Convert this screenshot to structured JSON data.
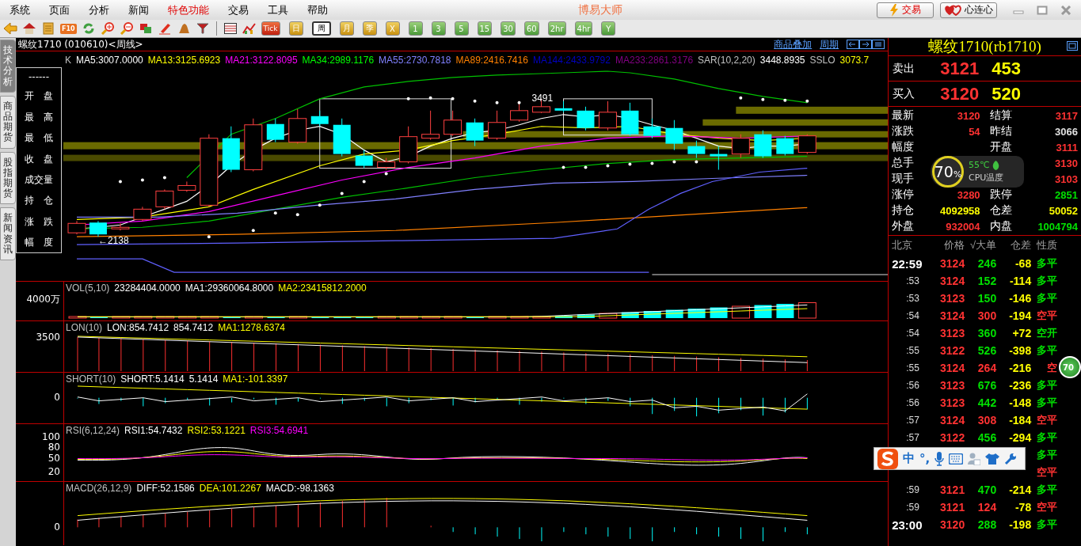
{
  "menu": [
    {
      "label": "系统",
      "highlight": false
    },
    {
      "label": "页面",
      "highlight": false
    },
    {
      "label": "分析",
      "highlight": false
    },
    {
      "label": "新闻",
      "highlight": false
    },
    {
      "label": "特色功能",
      "highlight": true
    },
    {
      "label": "交易",
      "highlight": false
    },
    {
      "label": "工具",
      "highlight": false
    },
    {
      "label": "帮助",
      "highlight": false
    }
  ],
  "app_title": "博易大师",
  "header_buttons": [
    {
      "label": "交易",
      "kind": "trade"
    },
    {
      "label": "心连心",
      "kind": "link"
    }
  ],
  "toolbar": {
    "f10_label": "F10",
    "periods": [
      {
        "label": "Tick",
        "kind": "tick",
        "selected": false
      },
      {
        "label": "日",
        "kind": "long",
        "selected": false
      },
      {
        "label": "周",
        "kind": "long",
        "selected": true
      },
      {
        "label": "月",
        "kind": "long",
        "selected": false
      },
      {
        "label": "季",
        "kind": "long",
        "selected": false
      },
      {
        "label": "X",
        "kind": "long",
        "selected": false
      },
      {
        "label": "1",
        "kind": "minute",
        "selected": false
      },
      {
        "label": "3",
        "kind": "minute",
        "selected": false
      },
      {
        "label": "5",
        "kind": "minute",
        "selected": false
      },
      {
        "label": "15",
        "kind": "minute",
        "selected": false
      },
      {
        "label": "30",
        "kind": "minute",
        "selected": false
      },
      {
        "label": "60",
        "kind": "minute",
        "selected": false
      },
      {
        "label": "2hr",
        "kind": "minute",
        "selected": false
      },
      {
        "label": "4hr",
        "kind": "minute",
        "selected": false
      },
      {
        "label": "Y",
        "kind": "minute",
        "selected": false
      }
    ]
  },
  "side_tabs": [
    {
      "label": "技术分析",
      "selected": true
    },
    {
      "label": "商品期货",
      "selected": false
    },
    {
      "label": "股指期货",
      "selected": false
    },
    {
      "label": "新闻资讯",
      "selected": false
    }
  ],
  "chart": {
    "title": "螺纹1710 (010610)<周线>",
    "links": [
      "商品叠加",
      "周期"
    ],
    "info_labels": [
      "------",
      "开　盘",
      "最　高",
      "最　低",
      "收　盘",
      "成交量",
      "持　仓",
      "涨　跌",
      "幅　度"
    ],
    "legend": [
      {
        "text": "K",
        "color": "#c0c0c0"
      },
      {
        "text": "MA5:3007.0000",
        "color": "#ffffff"
      },
      {
        "text": "MA13:3125.6923",
        "color": "#ffff00"
      },
      {
        "text": "MA21:3122.8095",
        "color": "#ff00ff"
      },
      {
        "text": "MA34:2989.1176",
        "color": "#00ff00"
      },
      {
        "text": "MA55:2730.7818",
        "color": "#8080ff"
      },
      {
        "text": "MA89:2416.7416",
        "color": "#ff8000"
      },
      {
        "text": "MA144:2433.9792",
        "color": "#0000c0"
      },
      {
        "text": "MA233:2861.3176",
        "color": "#800080"
      },
      {
        "text": "SAR(10,2,20)",
        "color": "#c0c0c0"
      },
      {
        "text": "3448.8935",
        "color": "#ffffff"
      },
      {
        "text": "SSLO",
        "color": "#c0c0c0"
      },
      {
        "text": "3073.7",
        "color": "#ffff00"
      }
    ],
    "price_labels": [
      "3491",
      "←2138"
    ],
    "panels": [
      {
        "kind": "vol",
        "ticks": [
          "4000万"
        ],
        "legend": [
          {
            "text": "VOL(5,10)",
            "color": "#c0c0c0"
          },
          {
            "text": "23284404.0000",
            "color": "#ffffff"
          },
          {
            "text": "MA1:29360064.8000",
            "color": "#ffffff"
          },
          {
            "text": "MA2:23415812.2000",
            "color": "#ffff00"
          }
        ]
      },
      {
        "kind": "lon",
        "ticks": [
          "3500"
        ],
        "legend": [
          {
            "text": "LON(10)",
            "color": "#c0c0c0"
          },
          {
            "text": "LON:854.7412",
            "color": "#ffffff"
          },
          {
            "text": "854.7412",
            "color": "#ffffff"
          },
          {
            "text": "MA1:1278.6374",
            "color": "#ffff00"
          }
        ]
      },
      {
        "kind": "short",
        "ticks": [
          "0"
        ],
        "legend": [
          {
            "text": "SHORT(10)",
            "color": "#c0c0c0"
          },
          {
            "text": "SHORT:5.1414",
            "color": "#ffffff"
          },
          {
            "text": "5.1414",
            "color": "#ffffff"
          },
          {
            "text": "MA1:-101.3397",
            "color": "#ffff00"
          }
        ]
      },
      {
        "kind": "rsi",
        "ticks": [
          "100",
          "80",
          "50",
          "20"
        ],
        "legend": [
          {
            "text": "RSI(6,12,24)",
            "color": "#c0c0c0"
          },
          {
            "text": "RSI1:54.7432",
            "color": "#ffffff"
          },
          {
            "text": "RSI2:53.1221",
            "color": "#ffff00"
          },
          {
            "text": "RSI3:54.6941",
            "color": "#ff00ff"
          }
        ]
      },
      {
        "kind": "macd",
        "ticks": [
          "0"
        ],
        "legend": [
          {
            "text": "MACD(26,12,9)",
            "color": "#c0c0c0"
          },
          {
            "text": "DIFF:52.1586",
            "color": "#ffffff"
          },
          {
            "text": "DEA:101.2267",
            "color": "#ffff00"
          },
          {
            "text": "MACD:-98.1363",
            "color": "#ffffff"
          }
        ]
      }
    ]
  },
  "quote": {
    "title": "螺纹1710(rb1710)",
    "ask": {
      "label": "卖出",
      "price": "3121",
      "volume": "453"
    },
    "bid": {
      "label": "买入",
      "price": "3120",
      "volume": "520"
    },
    "stats": [
      {
        "label": "最新",
        "value": "3120",
        "color": "#ff3232"
      },
      {
        "label": "结算",
        "value": "3117",
        "color": "#ff3232"
      },
      {
        "label": "涨跌",
        "value": "54",
        "color": "#ff3232"
      },
      {
        "label": "昨结",
        "value": "3066",
        "color": "#e0e0e0"
      },
      {
        "label": "幅度"
      },
      {
        "label": "开盘",
        "value": "3111",
        "color": "#ff3232"
      },
      {
        "label": "总手"
      },
      {
        "value": "3130",
        "color": "#ff3232"
      },
      {
        "label": "现手"
      },
      {
        "value": "3103",
        "color": "#ff3232"
      },
      {
        "label": "涨停",
        "value": "3280",
        "color": "#ff3232"
      },
      {
        "label": "跌停",
        "value": "2851",
        "color": "#00e000"
      },
      {
        "label": "持仓",
        "value": "4092958",
        "color": "#ffff00"
      },
      {
        "label": "仓差",
        "value": "50052",
        "color": "#ffff00"
      },
      {
        "label": "外盘",
        "value": "932004",
        "color": "#ff3232"
      },
      {
        "label": "内盘",
        "value": "1004794",
        "color": "#00e000"
      }
    ]
  },
  "cpu_widget": {
    "percent": "70",
    "unit": "%",
    "temperature": "55℃",
    "label": "CPU温度"
  },
  "trades": {
    "columns": [
      "北京",
      "价格",
      "√大单",
      "仓差",
      "性质"
    ],
    "rows": [
      {
        "kind": "hour",
        "time": "22:59",
        "price": "3124",
        "volume": "246",
        "change": "-68",
        "nature": "多平",
        "color": "#00e000"
      },
      {
        "kind": "minute",
        "time": ":53",
        "price": "3124",
        "volume": "152",
        "change": "-114",
        "nature": "多平",
        "color": "#00e000"
      },
      {
        "kind": "minute",
        "time": ":53",
        "price": "3123",
        "volume": "150",
        "change": "-146",
        "nature": "多平",
        "color": "#00e000"
      },
      {
        "kind": "minute",
        "time": ":54",
        "price": "3124",
        "volume": "300",
        "change": "-194",
        "nature": "空平",
        "color": "#ff3232"
      },
      {
        "kind": "minute",
        "time": ":54",
        "price": "3123",
        "volume": "360",
        "change": "+72",
        "nature": "空开",
        "color": "#00e000"
      },
      {
        "kind": "minute",
        "time": ":55",
        "price": "3122",
        "volume": "526",
        "change": "-398",
        "nature": "多平",
        "color": "#00e000"
      },
      {
        "kind": "minute",
        "time": ":55",
        "price": "3124",
        "volume": "264",
        "change": "-216",
        "nature": "空",
        "color": "#ff3232"
      },
      {
        "kind": "minute",
        "time": ":56",
        "price": "3123",
        "volume": "676",
        "change": "-236",
        "nature": "多平",
        "color": "#00e000"
      },
      {
        "kind": "minute",
        "time": ":56",
        "price": "3123",
        "volume": "442",
        "change": "-148",
        "nature": "多平",
        "color": "#00e000"
      },
      {
        "kind": "minute",
        "time": ":57",
        "price": "3124",
        "volume": "308",
        "change": "-184",
        "nature": "空平",
        "color": "#ff3232"
      },
      {
        "kind": "minute",
        "time": ":57",
        "price": "3122",
        "volume": "456",
        "change": "-294",
        "nature": "多平",
        "color": "#00e000"
      },
      {
        "kind": "minute",
        "nature": "多平",
        "color": "#00e000"
      },
      {
        "kind": "minute",
        "nature": "空平",
        "color": "#ff3232"
      },
      {
        "kind": "minute",
        "time": ":59",
        "price": "3121",
        "volume": "470",
        "change": "-214",
        "nature": "多平",
        "color": "#00e000"
      },
      {
        "kind": "minute",
        "time": ":59",
        "price": "3121",
        "volume": "124",
        "change": "-78",
        "nature": "空平",
        "color": "#ff3232"
      },
      {
        "kind": "hour",
        "time": "23:00",
        "price": "3120",
        "volume": "288",
        "change": "-198",
        "nature": "多平",
        "color": "#00e000"
      }
    ]
  },
  "ime_bar": {
    "mode": "中",
    "punctuation": "°,"
  },
  "float_ball": {
    "text": "70"
  }
}
